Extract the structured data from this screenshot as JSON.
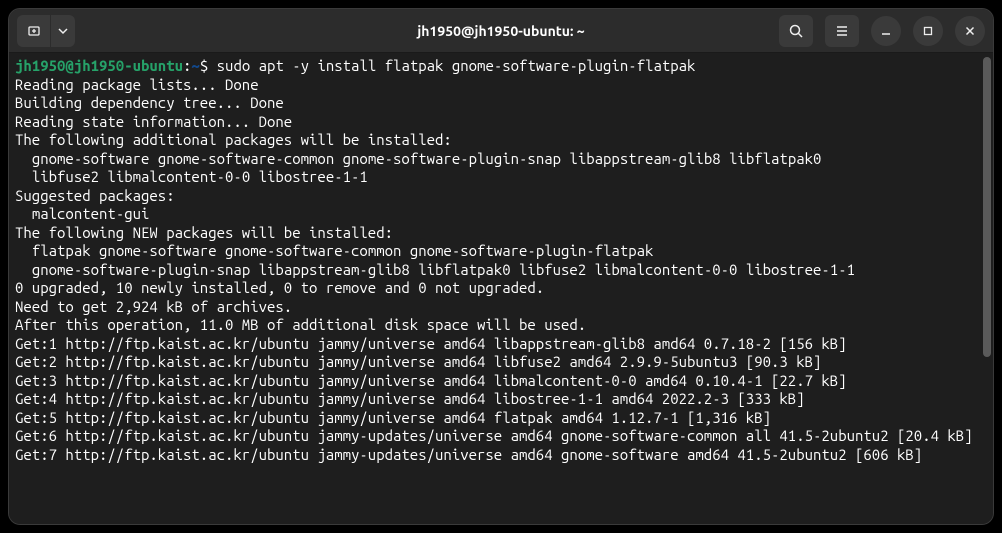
{
  "titlebar": {
    "title": "jh1950@jh1950-ubuntu: ~"
  },
  "prompt": {
    "user_host": "jh1950@jh1950-ubuntu",
    "colon": ":",
    "path": "~",
    "dollar": "$ ",
    "command": "sudo apt -y install flatpak gnome-software-plugin-flatpak"
  },
  "output": {
    "l1": "Reading package lists... Done",
    "l2": "Building dependency tree... Done",
    "l3": "Reading state information... Done",
    "l4": "The following additional packages will be installed:",
    "l5": "  gnome-software gnome-software-common gnome-software-plugin-snap libappstream-glib8 libflatpak0",
    "l6": "  libfuse2 libmalcontent-0-0 libostree-1-1",
    "l7": "Suggested packages:",
    "l8": "  malcontent-gui",
    "l9": "The following NEW packages will be installed:",
    "l10": "  flatpak gnome-software gnome-software-common gnome-software-plugin-flatpak",
    "l11": "  gnome-software-plugin-snap libappstream-glib8 libflatpak0 libfuse2 libmalcontent-0-0 libostree-1-1",
    "l12": "0 upgraded, 10 newly installed, 0 to remove and 0 not upgraded.",
    "l13": "Need to get 2,924 kB of archives.",
    "l14": "After this operation, 11.0 MB of additional disk space will be used.",
    "l15": "Get:1 http://ftp.kaist.ac.kr/ubuntu jammy/universe amd64 libappstream-glib8 amd64 0.7.18-2 [156 kB]",
    "l16": "Get:2 http://ftp.kaist.ac.kr/ubuntu jammy/universe amd64 libfuse2 amd64 2.9.9-5ubuntu3 [90.3 kB]",
    "l17": "Get:3 http://ftp.kaist.ac.kr/ubuntu jammy/universe amd64 libmalcontent-0-0 amd64 0.10.4-1 [22.7 kB]",
    "l18": "Get:4 http://ftp.kaist.ac.kr/ubuntu jammy/universe amd64 libostree-1-1 amd64 2022.2-3 [333 kB]",
    "l19": "Get:5 http://ftp.kaist.ac.kr/ubuntu jammy/universe amd64 flatpak amd64 1.12.7-1 [1,316 kB]",
    "l20": "Get:6 http://ftp.kaist.ac.kr/ubuntu jammy-updates/universe amd64 gnome-software-common all 41.5-2ubuntu2 [20.4 kB]",
    "l21": "Get:7 http://ftp.kaist.ac.kr/ubuntu jammy-updates/universe amd64 gnome-software amd64 41.5-2ubuntu2 [606 kB]"
  }
}
